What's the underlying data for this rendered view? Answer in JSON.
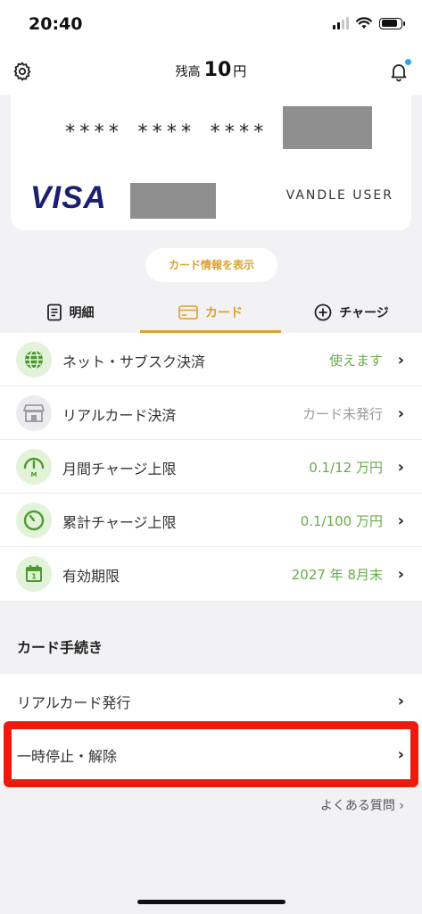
{
  "status_bar": {
    "time": "20:40"
  },
  "header": {
    "balance_label": "残高",
    "balance_amount": "10",
    "balance_unit": "円"
  },
  "card": {
    "number_masked": "**** **** ****",
    "brand": "VISA",
    "holder": "VANDLE USER"
  },
  "show_info_button": "カード情報を表示",
  "tabs": [
    {
      "label": "明細",
      "icon": "document-icon",
      "active": false
    },
    {
      "label": "カード",
      "icon": "card-icon",
      "active": true
    },
    {
      "label": "チャージ",
      "icon": "plus-circle-icon",
      "active": false
    }
  ],
  "card_info_rows": [
    {
      "label": "ネット・サブスク決済",
      "value": "使えます",
      "icon": "globe-icon"
    },
    {
      "label": "リアルカード決済",
      "value": "カード未発行",
      "icon": "store-icon"
    },
    {
      "label": "月間チャージ上限",
      "value": "0.1/12 万円",
      "icon": "monthly-gauge-icon"
    },
    {
      "label": "累計チャージ上限",
      "value": "0.1/100 万円",
      "icon": "gauge-icon"
    },
    {
      "label": "有効期限",
      "value": "2027 年 8月末",
      "icon": "calendar-icon"
    }
  ],
  "procedures": {
    "title": "カード手続き",
    "items": [
      {
        "label": "リアルカード発行"
      },
      {
        "label": "一時停止・解除"
      }
    ]
  },
  "faq_link": "よくある質問",
  "colors": {
    "accent": "#d9a233",
    "positive": "#6aab4a",
    "highlight": "#ef1a0e",
    "visa": "#1a1f71"
  }
}
